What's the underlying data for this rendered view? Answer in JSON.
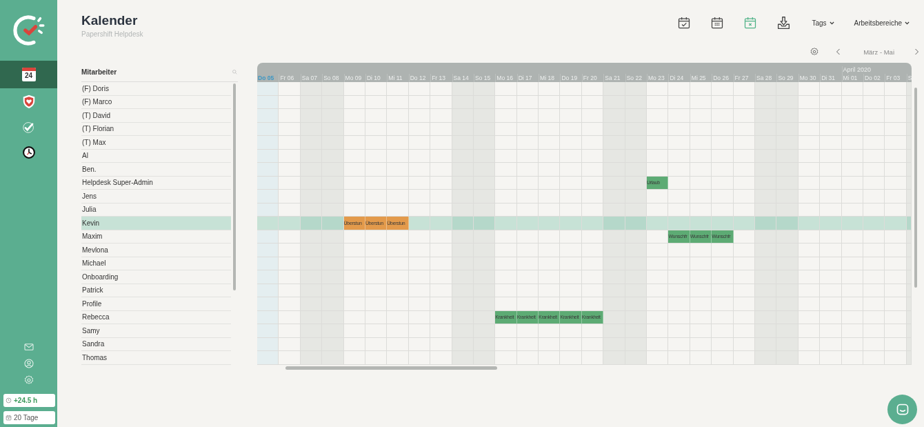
{
  "sidebar": {
    "nav": [
      {
        "kind": "calendar",
        "text": "24",
        "selected": true
      },
      {
        "kind": "shield",
        "selected": false
      },
      {
        "kind": "tasks",
        "selected": false
      },
      {
        "kind": "clock",
        "selected": false
      }
    ],
    "bottom": [
      {
        "kind": "mail"
      },
      {
        "kind": "user"
      },
      {
        "kind": "settings"
      }
    ],
    "badges": [
      {
        "kind": "clock",
        "text": "+24.5 h"
      },
      {
        "kind": "calendar",
        "text": "20 Tage"
      }
    ]
  },
  "header": {
    "title": "Kalender",
    "subtitle": "Papershift Helpdesk",
    "views": [
      {
        "kind": "calendar-check",
        "selected": false
      },
      {
        "kind": "calendar-grid",
        "selected": false
      },
      {
        "kind": "calendar-x",
        "selected": true
      },
      {
        "kind": "download",
        "selected": false
      }
    ],
    "dropdowns": [
      "Tags",
      "Arbeitsbereiche"
    ],
    "range": "März - Mai"
  },
  "employees": {
    "heading": "Mitarbeiter",
    "rows": [
      {
        "name": "(F) Doris",
        "selected": false
      },
      {
        "name": "(F) Marco",
        "selected": false
      },
      {
        "name": "(T) David",
        "selected": false
      },
      {
        "name": "(T) Florian",
        "selected": false
      },
      {
        "name": "(T) Max",
        "selected": false
      },
      {
        "name": "Al",
        "selected": false
      },
      {
        "name": "Ben.",
        "selected": false
      },
      {
        "name": "Helpdesk Super-Admin",
        "selected": false,
        "entries": [
          {
            "kind": "free"
          },
          {
            "kind": "free"
          },
          {
            "kind": "free"
          },
          {
            "kind": "free"
          },
          {
            "kind": "free"
          },
          {
            "kind": "free"
          },
          {
            "kind": "free"
          },
          {
            "kind": "free"
          },
          {
            "kind": "free"
          },
          {
            "kind": "free"
          },
          {
            "kind": "free"
          },
          {
            "kind": "free"
          },
          {
            "kind": "free"
          },
          {
            "kind": "free"
          },
          {
            "kind": "free"
          },
          {
            "kind": "free"
          },
          {
            "kind": "free"
          },
          {
            "kind": "free"
          },
          {
            "kind": "absence",
            "label": "Urlaub",
            "color": "#5dab74"
          }
        ]
      },
      {
        "name": "Jens",
        "selected": false
      },
      {
        "name": "Julia",
        "selected": false
      },
      {
        "name": "Kevin",
        "selected": true,
        "entries": [
          {
            "kind": "free"
          },
          {
            "kind": "free"
          },
          {
            "kind": "free"
          },
          {
            "kind": "free"
          },
          {
            "kind": "absence",
            "label": "Überstun",
            "color": "#e39a4b"
          },
          {
            "kind": "absence",
            "label": "Überstun",
            "color": "#e39a4b"
          },
          {
            "kind": "absence",
            "label": "Überstun",
            "color": "#e39a4b"
          }
        ]
      },
      {
        "name": "Maxim",
        "selected": false,
        "entries": [
          {
            "kind": "free"
          },
          {
            "kind": "free"
          },
          {
            "kind": "free"
          },
          {
            "kind": "free"
          },
          {
            "kind": "free"
          },
          {
            "kind": "free"
          },
          {
            "kind": "free"
          },
          {
            "kind": "free"
          },
          {
            "kind": "free"
          },
          {
            "kind": "free"
          },
          {
            "kind": "free"
          },
          {
            "kind": "free"
          },
          {
            "kind": "free"
          },
          {
            "kind": "free"
          },
          {
            "kind": "free"
          },
          {
            "kind": "free"
          },
          {
            "kind": "free"
          },
          {
            "kind": "free"
          },
          {
            "kind": "free"
          },
          {
            "kind": "absence",
            "label": "Wunschfr",
            "color": "#5dab74"
          },
          {
            "kind": "absence",
            "label": "Wunschfr",
            "color": "#5dab74"
          },
          {
            "kind": "absence",
            "label": "Wunschfr",
            "color": "#5dab74"
          }
        ]
      },
      {
        "name": "Mevlona",
        "selected": false
      },
      {
        "name": "Michael",
        "selected": false
      },
      {
        "name": "Onboarding",
        "selected": false
      },
      {
        "name": "Patrick",
        "selected": false
      },
      {
        "name": "Profile",
        "selected": false
      },
      {
        "name": "Rebecca",
        "selected": false,
        "entries": [
          {
            "kind": "free"
          },
          {
            "kind": "free"
          },
          {
            "kind": "free"
          },
          {
            "kind": "free"
          },
          {
            "kind": "free"
          },
          {
            "kind": "free"
          },
          {
            "kind": "free"
          },
          {
            "kind": "free"
          },
          {
            "kind": "free"
          },
          {
            "kind": "free"
          },
          {
            "kind": "free"
          },
          {
            "kind": "absence",
            "label": "Krankheit",
            "color": "#5dab74"
          },
          {
            "kind": "absence",
            "label": "Krankheit",
            "color": "#5dab74"
          },
          {
            "kind": "absence",
            "label": "Krankheit",
            "color": "#5dab74"
          },
          {
            "kind": "absence",
            "label": "Krankheit",
            "color": "#5dab74"
          },
          {
            "kind": "absence",
            "label": "Krankheit",
            "color": "#5dab74"
          }
        ]
      },
      {
        "name": "Samy",
        "selected": false
      },
      {
        "name": "Sandra",
        "selected": false
      },
      {
        "name": "Thomas",
        "selected": false
      }
    ]
  },
  "days": [
    {
      "label": "Do 05",
      "kind": "today"
    },
    {
      "label": "Fr 06",
      "kind": "weekday"
    },
    {
      "label": "Sa 07",
      "kind": "weekend"
    },
    {
      "label": "So 08",
      "kind": "weekend"
    },
    {
      "label": "Mo 09",
      "kind": "weekday"
    },
    {
      "label": "Di 10",
      "kind": "weekday"
    },
    {
      "label": "Mi 11",
      "kind": "weekday"
    },
    {
      "label": "Do 12",
      "kind": "weekday"
    },
    {
      "label": "Fr 13",
      "kind": "weekday"
    },
    {
      "label": "Sa 14",
      "kind": "weekend"
    },
    {
      "label": "So 15",
      "kind": "weekend"
    },
    {
      "label": "Mo 16",
      "kind": "weekday"
    },
    {
      "label": "Di 17",
      "kind": "weekday"
    },
    {
      "label": "Mi 18",
      "kind": "weekday"
    },
    {
      "label": "Do 19",
      "kind": "weekday"
    },
    {
      "label": "Fr 20",
      "kind": "weekday"
    },
    {
      "label": "Sa 21",
      "kind": "weekend"
    },
    {
      "label": "So 22",
      "kind": "weekend"
    },
    {
      "label": "Mo 23",
      "kind": "weekday"
    },
    {
      "label": "Di 24",
      "kind": "weekday"
    },
    {
      "label": "Mi 25",
      "kind": "weekday"
    },
    {
      "label": "Do 26",
      "kind": "weekday"
    },
    {
      "label": "Fr 27",
      "kind": "weekday"
    },
    {
      "label": "Sa 28",
      "kind": "weekend"
    },
    {
      "label": "So 29",
      "kind": "weekend"
    },
    {
      "label": "Mo 30",
      "kind": "weekday"
    },
    {
      "label": "Di 31",
      "kind": "weekday"
    },
    {
      "label": "Mi 01",
      "kind": "weekday",
      "month": "April 2020"
    },
    {
      "label": "Do 02",
      "kind": "weekday"
    },
    {
      "label": "Fr 03",
      "kind": "weekday"
    },
    {
      "label": "S",
      "kind": "weekend"
    }
  ]
}
